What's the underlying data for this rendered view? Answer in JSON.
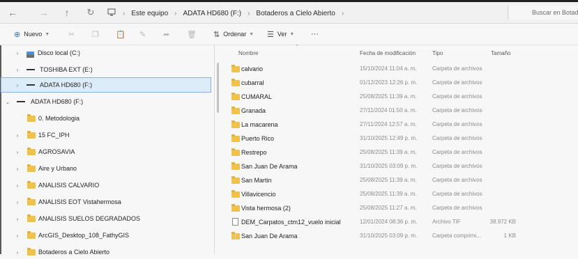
{
  "colors": {
    "accent": "#3c6fc4",
    "folder": "#f0c24c",
    "selected_bg": "#dcecf9"
  },
  "nav": {
    "back_icon": "arrow-left-icon",
    "forward_icon": "arrow-right-icon",
    "up_icon": "arrow-up-icon",
    "refresh_icon": "refresh-icon"
  },
  "breadcrumb": {
    "items": [
      "Este equipo",
      "ADATA HD680 (F:)",
      "Botaderos a Cielo Abierto"
    ]
  },
  "search": {
    "placeholder": "Buscar en Botaderos a Cielo Abierto"
  },
  "toolbar": {
    "new_label": "Nuevo",
    "sort_label": "Ordenar",
    "view_label": "Ver",
    "more_label": "···"
  },
  "sidebar": {
    "items": [
      {
        "label": "Disco local (C:)",
        "icon": "drive-c-icon"
      },
      {
        "label": "TOSHIBA EXT (E:)",
        "icon": "drive-icon"
      },
      {
        "label": "ADATA HD680 (F:)",
        "icon": "drive-icon"
      },
      {
        "label": "ADATA HD680 (F:)",
        "icon": "drive-icon"
      },
      {
        "label": "0. Metodologia",
        "icon": "folder-icon"
      },
      {
        "label": "15 FC_IPH",
        "icon": "folder-icon"
      },
      {
        "label": "AGROSAVIA",
        "icon": "folder-icon"
      },
      {
        "label": "Aire y Urbano",
        "icon": "folder-icon"
      },
      {
        "label": "ANALISIS CALVARIO",
        "icon": "folder-icon"
      },
      {
        "label": "ANALISIS EOT Vistahermosa",
        "icon": "folder-icon"
      },
      {
        "label": "ANALISIS SUELOS DEGRADADOS",
        "icon": "folder-icon"
      },
      {
        "label": "ArcGIS_Desktop_108_FathyGIS",
        "icon": "folder-icon"
      },
      {
        "label": "Botaderos a Cielo Abierto",
        "icon": "folder-icon"
      }
    ]
  },
  "columns": {
    "name": "Nombre",
    "date": "Fecha de modificación",
    "type": "Tipo",
    "size": "Tamaño"
  },
  "files": [
    {
      "name": "calvario",
      "date": "15/10/2024 11:04 a. m.",
      "type": "Carpeta de archivos",
      "size": "",
      "icon": "folder-icon"
    },
    {
      "name": "cubarral",
      "date": "01/12/2023 12:26 p. m.",
      "type": "Carpeta de archivos",
      "size": "",
      "icon": "folder-icon"
    },
    {
      "name": "CUMARAL",
      "date": "25/08/2025 11:39 a. m.",
      "type": "Carpeta de archivos",
      "size": "",
      "icon": "folder-icon"
    },
    {
      "name": "Granada",
      "date": "27/11/2024 01:50 a. m.",
      "type": "Carpeta de archivos",
      "size": "",
      "icon": "folder-icon"
    },
    {
      "name": "La macarena",
      "date": "27/11/2024 12:57 a. m.",
      "type": "Carpeta de archivos",
      "size": "",
      "icon": "folder-icon"
    },
    {
      "name": "Puerto Rico",
      "date": "31/10/2025 12:49 p. m.",
      "type": "Carpeta de archivos",
      "size": "",
      "icon": "folder-icon"
    },
    {
      "name": "Restrepo",
      "date": "25/08/2025 11:39 a. m.",
      "type": "Carpeta de archivos",
      "size": "",
      "icon": "folder-icon"
    },
    {
      "name": "San Juan De Arama",
      "date": "31/10/2025 03:09 p. m.",
      "type": "Carpeta de archivos",
      "size": "",
      "icon": "folder-icon"
    },
    {
      "name": "San Martin",
      "date": "25/08/2025 11:39 a. m.",
      "type": "Carpeta de archivos",
      "size": "",
      "icon": "folder-icon"
    },
    {
      "name": "Villavicencio",
      "date": "25/08/2025 11:39 a. m.",
      "type": "Carpeta de archivos",
      "size": "",
      "icon": "folder-icon"
    },
    {
      "name": "Vista hermosa (2)",
      "date": "25/08/2025 11:27 a. m.",
      "type": "Carpeta de archivos",
      "size": "",
      "icon": "folder-icon"
    },
    {
      "name": "DEM_Carpatos_ctm12_vuelo inicial",
      "date": "12/01/2024 08:36 p. m.",
      "type": "Archivo TIF",
      "size": "38.972 KB",
      "icon": "file-icon"
    },
    {
      "name": "San Juan De Arama",
      "date": "31/10/2025 03:09 p. m.",
      "type": "Carpeta comprimi...",
      "size": "1 KB",
      "icon": "zip-folder-icon"
    }
  ]
}
